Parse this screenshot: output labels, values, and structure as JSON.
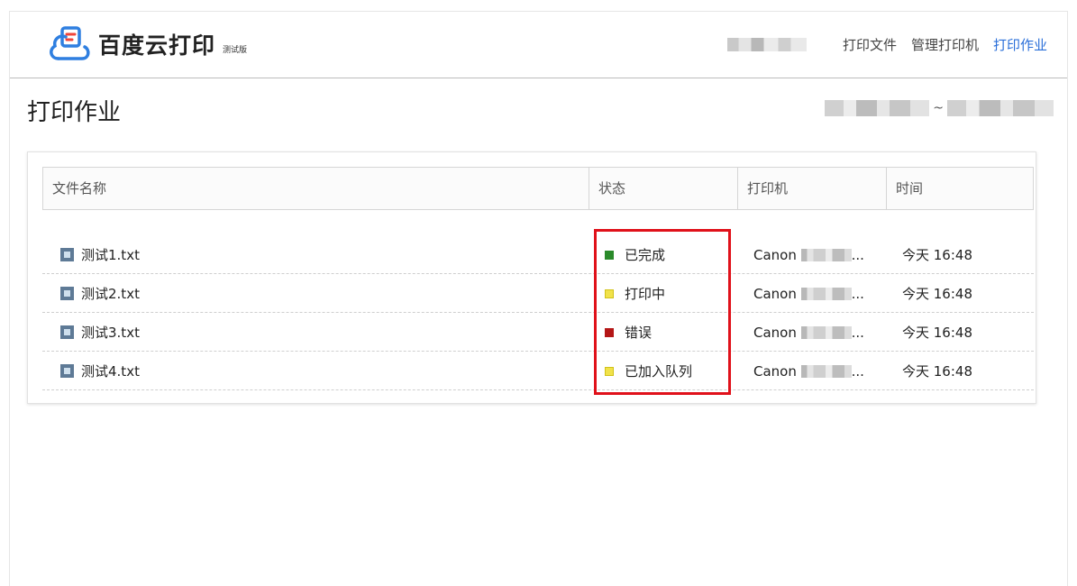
{
  "header": {
    "logo_text": "百度云打印",
    "logo_sub": "测试版",
    "nav": [
      "打印文件",
      "管理打印机",
      "打印作业"
    ],
    "active_nav": "打印作业"
  },
  "page": {
    "title": "打印作业",
    "date_separator": "~"
  },
  "table": {
    "columns": [
      "文件名称",
      "状态",
      "打印机",
      "时间"
    ],
    "rows": [
      {
        "file": "测试1.txt",
        "status": "已完成",
        "status_type": "done",
        "printer": "Canon",
        "time": "今天 16:48"
      },
      {
        "file": "测试2.txt",
        "status": "打印中",
        "status_type": "printing",
        "printer": "Canon",
        "time": "今天 16:48"
      },
      {
        "file": "测试3.txt",
        "status": "错误",
        "status_type": "error",
        "printer": "Canon",
        "time": "今天 16:48"
      },
      {
        "file": "测试4.txt",
        "status": "已加入队列",
        "status_type": "queued",
        "printer": "Canon",
        "time": "今天 16:48"
      }
    ]
  },
  "colors": {
    "accent": "#2a6fd9",
    "status_done": "#2a8a2a",
    "status_printing": "#f1e24a",
    "status_error": "#b41616",
    "status_queued": "#f1e24a",
    "highlight": "#e0111a"
  },
  "icons": {
    "logo": "cloud-print-icon",
    "file": "text-file-icon"
  }
}
